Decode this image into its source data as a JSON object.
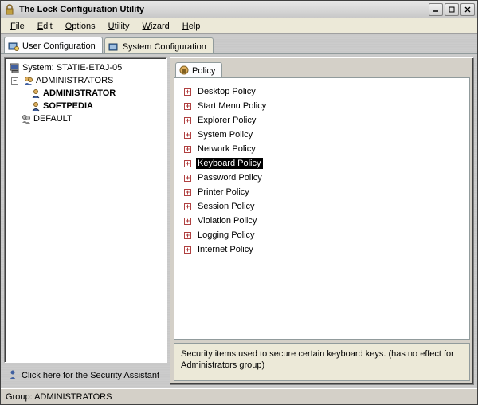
{
  "window": {
    "title": "The Lock Configuration Utility"
  },
  "menu": {
    "file": "File",
    "edit": "Edit",
    "options": "Options",
    "utility": "Utility",
    "wizard": "Wizard",
    "help": "Help"
  },
  "tabs": {
    "user": "User Configuration",
    "system": "System Configuration"
  },
  "tree": {
    "root": "System: STATIE-ETAJ-05",
    "admins": "ADMINISTRATORS",
    "admin": "ADMINISTRATOR",
    "softpedia": "SOFTPEDIA",
    "default": "DEFAULT"
  },
  "assistant_link": "Click here for the Security Assistant",
  "policy_tab": "Policy",
  "policies": [
    "Desktop Policy",
    "Start Menu Policy",
    "Explorer Policy",
    "System Policy",
    "Network Policy",
    "Keyboard Policy",
    "Password Policy",
    "Printer Policy",
    "Session Policy",
    "Violation Policy",
    "Logging Policy",
    "Internet Policy"
  ],
  "selected_policy_index": 5,
  "description": "Security items used to secure certain keyboard keys. (has no effect for Administrators group)",
  "status": "Group: ADMINISTRATORS"
}
